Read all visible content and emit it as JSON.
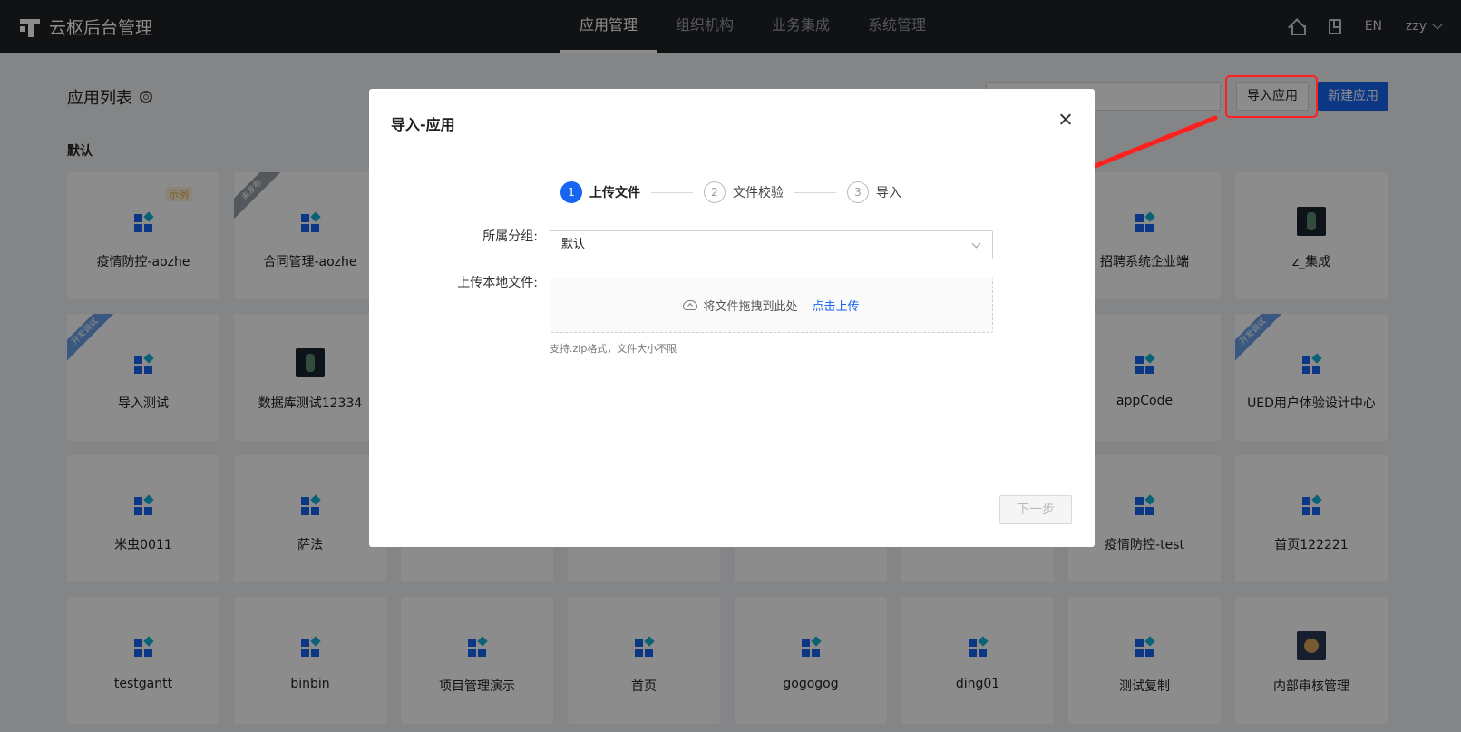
{
  "header": {
    "title": "云枢后台管理",
    "nav": [
      "应用管理",
      "组织机构",
      "业务集成",
      "系统管理"
    ],
    "lang": "EN",
    "user": "zzy"
  },
  "page": {
    "title": "应用列表",
    "import_label": "导入应用",
    "new_label": "新建应用",
    "group": "默认"
  },
  "cards": [
    {
      "name": "疫情防控-aozhe",
      "icon": "app-icon",
      "tag": "示例"
    },
    {
      "name": "合同管理-aozhe",
      "icon": "app-icon",
      "ribbon": "未发布",
      "ribbon_color": "gray"
    },
    {
      "name": "",
      "icon": "hidden"
    },
    {
      "name": "",
      "icon": "hidden"
    },
    {
      "name": "",
      "icon": "hidden"
    },
    {
      "name": "",
      "icon": "hidden"
    },
    {
      "name": "招聘系统企业端",
      "icon": "app-icon"
    },
    {
      "name": "z_集成",
      "icon": "robot-image"
    },
    {
      "name": "导入测试",
      "icon": "app-icon",
      "ribbon": "开发调试",
      "ribbon_color": "blue"
    },
    {
      "name": "数据库测试12334",
      "icon": "robot-image"
    },
    {
      "name": "",
      "icon": "hidden"
    },
    {
      "name": "",
      "icon": "hidden"
    },
    {
      "name": "",
      "icon": "hidden"
    },
    {
      "name": "",
      "icon": "hidden"
    },
    {
      "name": "appCode",
      "icon": "app-icon"
    },
    {
      "name": "UED用户体验设计中心",
      "icon": "app-icon",
      "ribbon": "开发调试",
      "ribbon_color": "blue"
    },
    {
      "name": "米虫0011",
      "icon": "app-icon"
    },
    {
      "name": "萨法",
      "icon": "app-icon"
    },
    {
      "name": "",
      "icon": "hidden"
    },
    {
      "name": "",
      "icon": "hidden"
    },
    {
      "name": "",
      "icon": "hidden"
    },
    {
      "name": "",
      "icon": "hidden"
    },
    {
      "name": "疫情防控-test",
      "icon": "app-icon"
    },
    {
      "name": "首页122221",
      "icon": "app-icon"
    },
    {
      "name": "testgantt",
      "icon": "app-icon"
    },
    {
      "name": "binbin",
      "icon": "app-icon"
    },
    {
      "name": "项目管理演示",
      "icon": "app-icon"
    },
    {
      "name": "首页",
      "icon": "app-icon"
    },
    {
      "name": "gogogog",
      "icon": "app-icon"
    },
    {
      "name": "ding01",
      "icon": "app-icon"
    },
    {
      "name": "测试复制",
      "icon": "app-icon"
    },
    {
      "name": "内部审核管理",
      "icon": "bear-image"
    }
  ],
  "modal": {
    "title": "导入-应用",
    "steps": [
      {
        "num": "1",
        "label": "上传文件",
        "active": true
      },
      {
        "num": "2",
        "label": "文件校验",
        "active": false
      },
      {
        "num": "3",
        "label": "导入",
        "active": false
      }
    ],
    "group_label": "所属分组:",
    "group_value": "默认",
    "file_label": "上传本地文件:",
    "drag_text": "将文件拖拽到此处",
    "upload_link": "点击上传",
    "hint": "支持.zip格式，文件大小不限",
    "next_label": "下一步"
  },
  "colors": {
    "accent": "#1765f0",
    "highlight": "#ff2020"
  }
}
